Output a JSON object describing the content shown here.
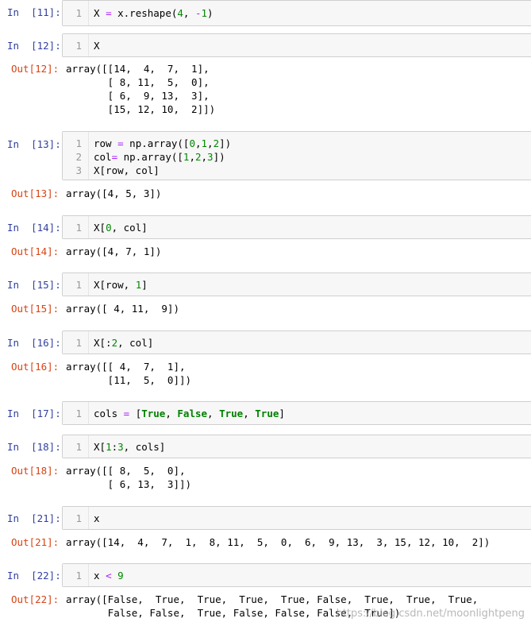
{
  "cells": [
    {
      "id": "c11",
      "in_label": "In  [11]:",
      "lines": [
        {
          "n": "1",
          "code": "X = x.reshape(4, -1)"
        }
      ]
    },
    {
      "id": "c12",
      "in_label": "In  [12]:",
      "lines": [
        {
          "n": "1",
          "code": "X"
        }
      ],
      "out_label": "Out[12]:",
      "output": "array([[14,  4,  7,  1],\n       [ 8, 11,  5,  0],\n       [ 6,  9, 13,  3],\n       [15, 12, 10,  2]])"
    },
    {
      "id": "c13",
      "in_label": "In  [13]:",
      "lines": [
        {
          "n": "1",
          "code": "row = np.array([0,1,2])"
        },
        {
          "n": "2",
          "code": "col= np.array([1,2,3])"
        },
        {
          "n": "3",
          "code": "X[row, col]"
        }
      ],
      "out_label": "Out[13]:",
      "output": "array([4, 5, 3])"
    },
    {
      "id": "c14",
      "in_label": "In  [14]:",
      "lines": [
        {
          "n": "1",
          "code": "X[0, col]"
        }
      ],
      "out_label": "Out[14]:",
      "output": "array([4, 7, 1])"
    },
    {
      "id": "c15",
      "in_label": "In  [15]:",
      "lines": [
        {
          "n": "1",
          "code": "X[row, 1]"
        }
      ],
      "out_label": "Out[15]:",
      "output": "array([ 4, 11,  9])"
    },
    {
      "id": "c16",
      "in_label": "In  [16]:",
      "lines": [
        {
          "n": "1",
          "code": "X[:2, col]"
        }
      ],
      "out_label": "Out[16]:",
      "output": "array([[ 4,  7,  1],\n       [11,  5,  0]])"
    },
    {
      "id": "c17",
      "in_label": "In  [17]:",
      "lines": [
        {
          "n": "1",
          "code": "cols = [True, False, True, True]"
        }
      ]
    },
    {
      "id": "c18",
      "in_label": "In  [18]:",
      "lines": [
        {
          "n": "1",
          "code": "X[1:3, cols]"
        }
      ],
      "out_label": "Out[18]:",
      "output": "array([[ 8,  5,  0],\n       [ 6, 13,  3]])"
    },
    {
      "id": "c21",
      "in_label": "In  [21]:",
      "lines": [
        {
          "n": "1",
          "code": "x"
        }
      ],
      "out_label": "Out[21]:",
      "output": "array([14,  4,  7,  1,  8, 11,  5,  0,  6,  9, 13,  3, 15, 12, 10,  2])"
    },
    {
      "id": "c22",
      "in_label": "In  [22]:",
      "lines": [
        {
          "n": "1",
          "code": "x < 9"
        }
      ],
      "out_label": "Out[22]:",
      "output": "array([False,  True,  True,  True,  True, False,  True,  True,  True,\n       False, False,  True, False, False, False,  True])"
    }
  ],
  "watermark": "https://blog.csdn.net/moonlightpeng",
  "colors": {
    "prompt_in": "#303f9f",
    "prompt_out": "#d84315",
    "cell_bg": "#f7f7f7",
    "cell_border": "#cfcfcf"
  }
}
